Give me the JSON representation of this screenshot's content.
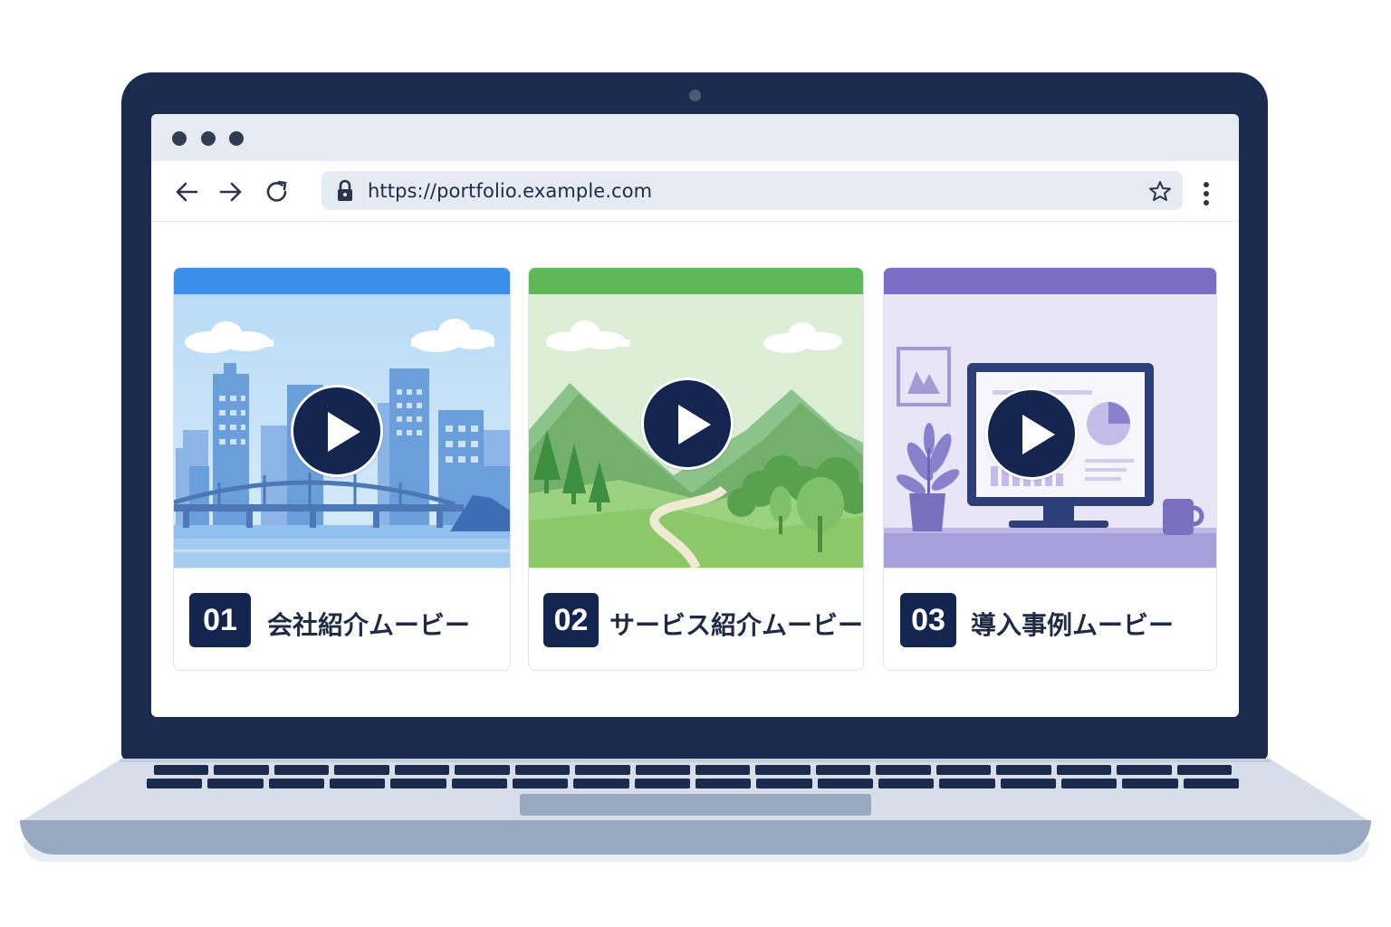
{
  "browser": {
    "url": "https://portfolio.example.com",
    "window_dots": [
      "close",
      "minimize",
      "maximize"
    ],
    "nav_icons": [
      "back-arrow-icon",
      "forward-arrow-icon",
      "reload-icon"
    ],
    "address_icons": [
      "lock-icon",
      "star-icon"
    ],
    "menu_icon": "vertical-dots-icon"
  },
  "cards": [
    {
      "number": "01",
      "title": "会社紹介ムービー",
      "accent": "#3b8eea",
      "thumbnail": "city-skyline-with-bridge"
    },
    {
      "number": "02",
      "title": "サービス紹介ムービー",
      "accent": "#5cb858",
      "thumbnail": "green-mountains-and-path"
    },
    {
      "number": "03",
      "title": "導入事例ムービー",
      "accent": "#7b6dc4",
      "thumbnail": "office-desk-with-monitor"
    }
  ],
  "colors": {
    "laptop_frame": "#1b2b4d",
    "number_badge": "#142650",
    "play_button": "#142650"
  }
}
